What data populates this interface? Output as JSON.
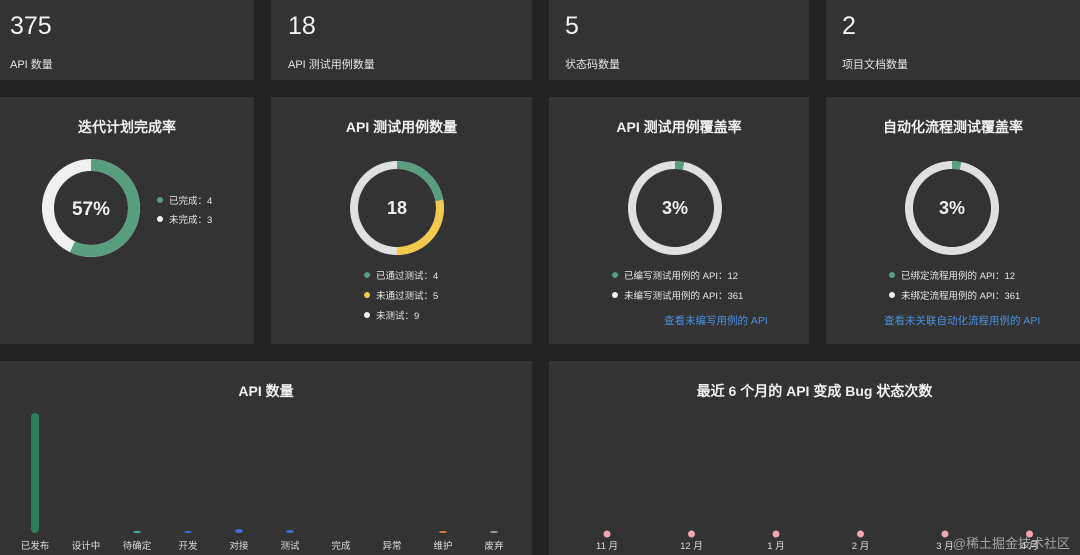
{
  "stats": [
    {
      "value": "375",
      "label": "API 数量"
    },
    {
      "value": "18",
      "label": "API 测试用例数量"
    },
    {
      "value": "5",
      "label": "状态码数量"
    },
    {
      "value": "2",
      "label": "项目文档数量"
    }
  ],
  "iteration": {
    "title": "迭代计划完成率",
    "center": "57%",
    "legend": [
      "已完成：4",
      "未完成：3"
    ]
  },
  "testcases": {
    "title": "API 测试用例数量",
    "center": "18",
    "legend": [
      "已通过测试：4",
      "未通过测试：5",
      "未测试：9"
    ]
  },
  "coverage": {
    "title": "API 测试用例覆盖率",
    "center": "3%",
    "legend": [
      "已编写测试用例的 API：12",
      "未编写测试用例的 API：361"
    ],
    "link": "查看未编写用例的 API"
  },
  "autoflow": {
    "title": "自动化流程测试覆盖率",
    "center": "3%",
    "legend": [
      "已绑定流程用例的 API：12",
      "未绑定流程用例的 API：361"
    ],
    "link": "查看未关联自动化流程用例的 API"
  },
  "colors": {
    "green": "#5a9e80",
    "white": "#f0f0f0",
    "yellow": "#f2c94c",
    "grey": "#e0e0e0",
    "blue": "#3b6fd6"
  },
  "chart_data": [
    {
      "type": "bar",
      "title": "API 数量",
      "categories": [
        "已发布",
        "设计中",
        "待确定",
        "开发",
        "对接",
        "测试",
        "完成",
        "异常",
        "维护",
        "废弃"
      ],
      "values": [
        355,
        0,
        3,
        2,
        12,
        9,
        0,
        0,
        1,
        1
      ],
      "colors": [
        "#2e7d5a",
        "#2e7d5a",
        "#3fb3a6",
        "#3b6fd6",
        "#3b6fd6",
        "#3b6fd6",
        "#3b6fd6",
        "#3b6fd6",
        "#e07b39",
        "#9e9e9e"
      ]
    },
    {
      "type": "line",
      "title": "最近 6 个月的 API 变成 Bug 状态次数",
      "categories": [
        "11 月",
        "12 月",
        "1 月",
        "2 月",
        "3 月",
        "4 月"
      ],
      "values": [
        0,
        0,
        0,
        0,
        0,
        0
      ],
      "point_color": "#f4a6b0"
    }
  ],
  "watermark": "@稀土掘金技术社区"
}
